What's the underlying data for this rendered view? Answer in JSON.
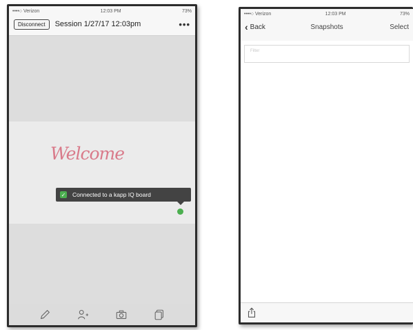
{
  "left_phone": {
    "status": {
      "carrier": "••••○ Verizon",
      "time": "12:03 PM",
      "battery": "73%"
    },
    "header": {
      "disconnect_label": "Disconnect",
      "session_title": "Session 1/27/17 12:03pm",
      "more_label": "•••"
    },
    "board": {
      "welcome_text": "Welcome"
    },
    "toast": {
      "message": "Connected to a kapp IQ board",
      "status_color": "#4caf50"
    },
    "toolbar": {
      "icons": [
        "pencil-icon",
        "add-person-icon",
        "camera-icon",
        "copy-icon"
      ]
    }
  },
  "right_phone": {
    "status": {
      "carrier": "••••○ Verizon",
      "time": "12:03 PM",
      "battery": "73%"
    },
    "nav": {
      "back_label": "Back",
      "title": "Snapshots",
      "select_label": "Select"
    },
    "filter": {
      "placeholder": "Filter"
    },
    "bottombar": {
      "icons": [
        "share-icon"
      ]
    }
  }
}
